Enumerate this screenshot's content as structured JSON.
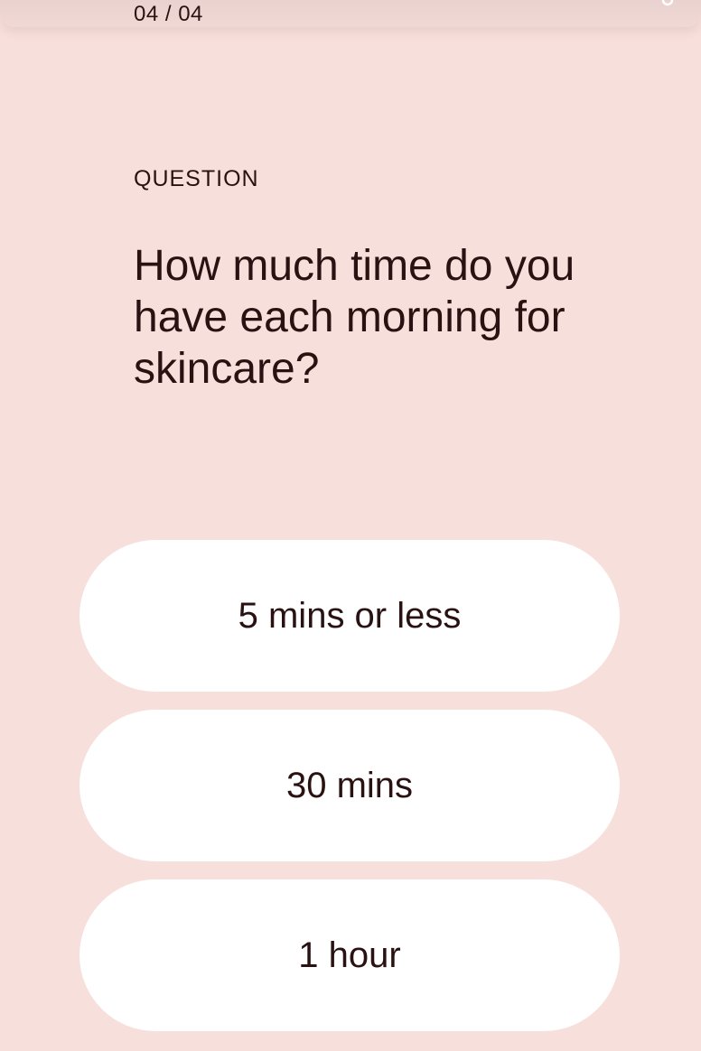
{
  "header": {
    "step": "04 / 04",
    "corner_icon": "refresh-icon"
  },
  "question": {
    "label": "QUESTION",
    "text": "How much time do you have each morning for skincare?"
  },
  "options": [
    {
      "label": "5 mins or less"
    },
    {
      "label": "30 mins"
    },
    {
      "label": "1 hour"
    }
  ],
  "colors": {
    "background": "#f7dfdc",
    "option_background": "#ffffff",
    "text": "#2a1212"
  }
}
